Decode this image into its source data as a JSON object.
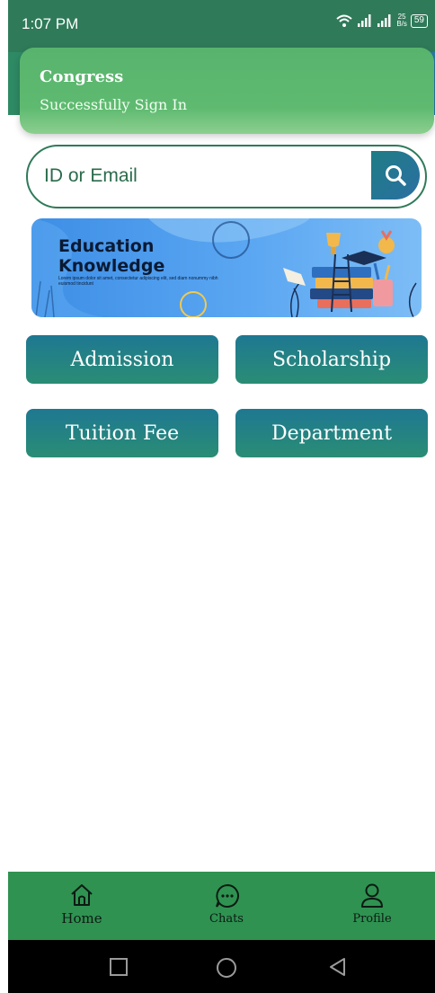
{
  "status_bar": {
    "time": "1:07 PM",
    "speed_value": "25",
    "speed_unit": "B/s",
    "battery": "59"
  },
  "toast": {
    "title": "Congress",
    "message": "Successfully Sign In"
  },
  "search": {
    "placeholder": "ID or Email"
  },
  "banner": {
    "title_line1": "Education",
    "title_line2": "Knowledge",
    "subtext": "Lorem ipsum dolor sit amet, consectetur adipiscing elit, sed diam nonummy nibh euismod tincidunt"
  },
  "actions": [
    {
      "label": "Admission"
    },
    {
      "label": "Scholarship"
    },
    {
      "label": "Tuition Fee"
    },
    {
      "label": "Department"
    }
  ],
  "bottom_nav": {
    "items": [
      {
        "label": "Home",
        "icon": "home-icon"
      },
      {
        "label": "Chats",
        "icon": "chat-icon"
      },
      {
        "label": "Profile",
        "icon": "profile-icon"
      }
    ]
  },
  "system_nav": {
    "icons": [
      "recent-apps-icon",
      "home-circle-icon",
      "back-icon"
    ]
  },
  "colors": {
    "primary_green": "#2f7a59",
    "nav_green": "#2f9251",
    "toast_green": "#5fba70",
    "button_teal": "#1e7892"
  }
}
